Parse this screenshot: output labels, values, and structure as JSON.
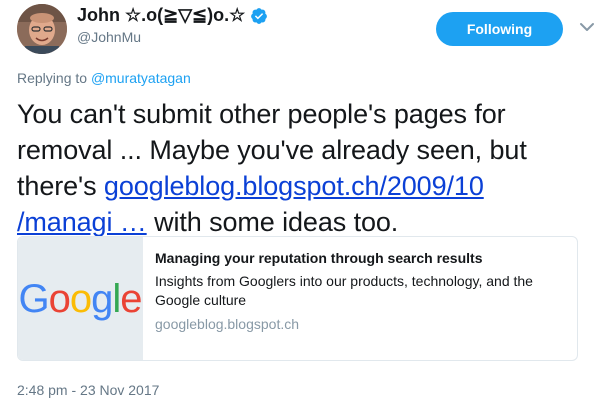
{
  "author": {
    "display_name": "John ☆.o(≧▽≦)o.☆",
    "handle": "@JohnMu",
    "verified": true,
    "avatar_icon": "avatar-photo"
  },
  "follow_button": {
    "label": "Following",
    "color": "#1da1f2"
  },
  "menu_icon": "chevron-down-icon",
  "reply": {
    "prefix": "Replying to ",
    "mention": "@muratyatagan"
  },
  "tweet": {
    "text_before": "You can't submit other people's pages for removal ... Maybe you've already seen, but there's ",
    "link_line1": "googleblog.blogspot.ch/2009/10",
    "link_line2": "/managi …",
    "text_after": " with some ideas too."
  },
  "card": {
    "thumbnail_icon": "google-logo",
    "thumbnail_text": "Google",
    "title": "Managing your reputation through search results",
    "description": "Insights from Googlers into our products, technology, and the Google culture",
    "domain": "googleblog.blogspot.ch"
  },
  "timestamp": "2:48 pm - 23 Nov 2017",
  "colors": {
    "link": "#0b40d6",
    "accent": "#1da1f2",
    "muted": "#657786"
  }
}
